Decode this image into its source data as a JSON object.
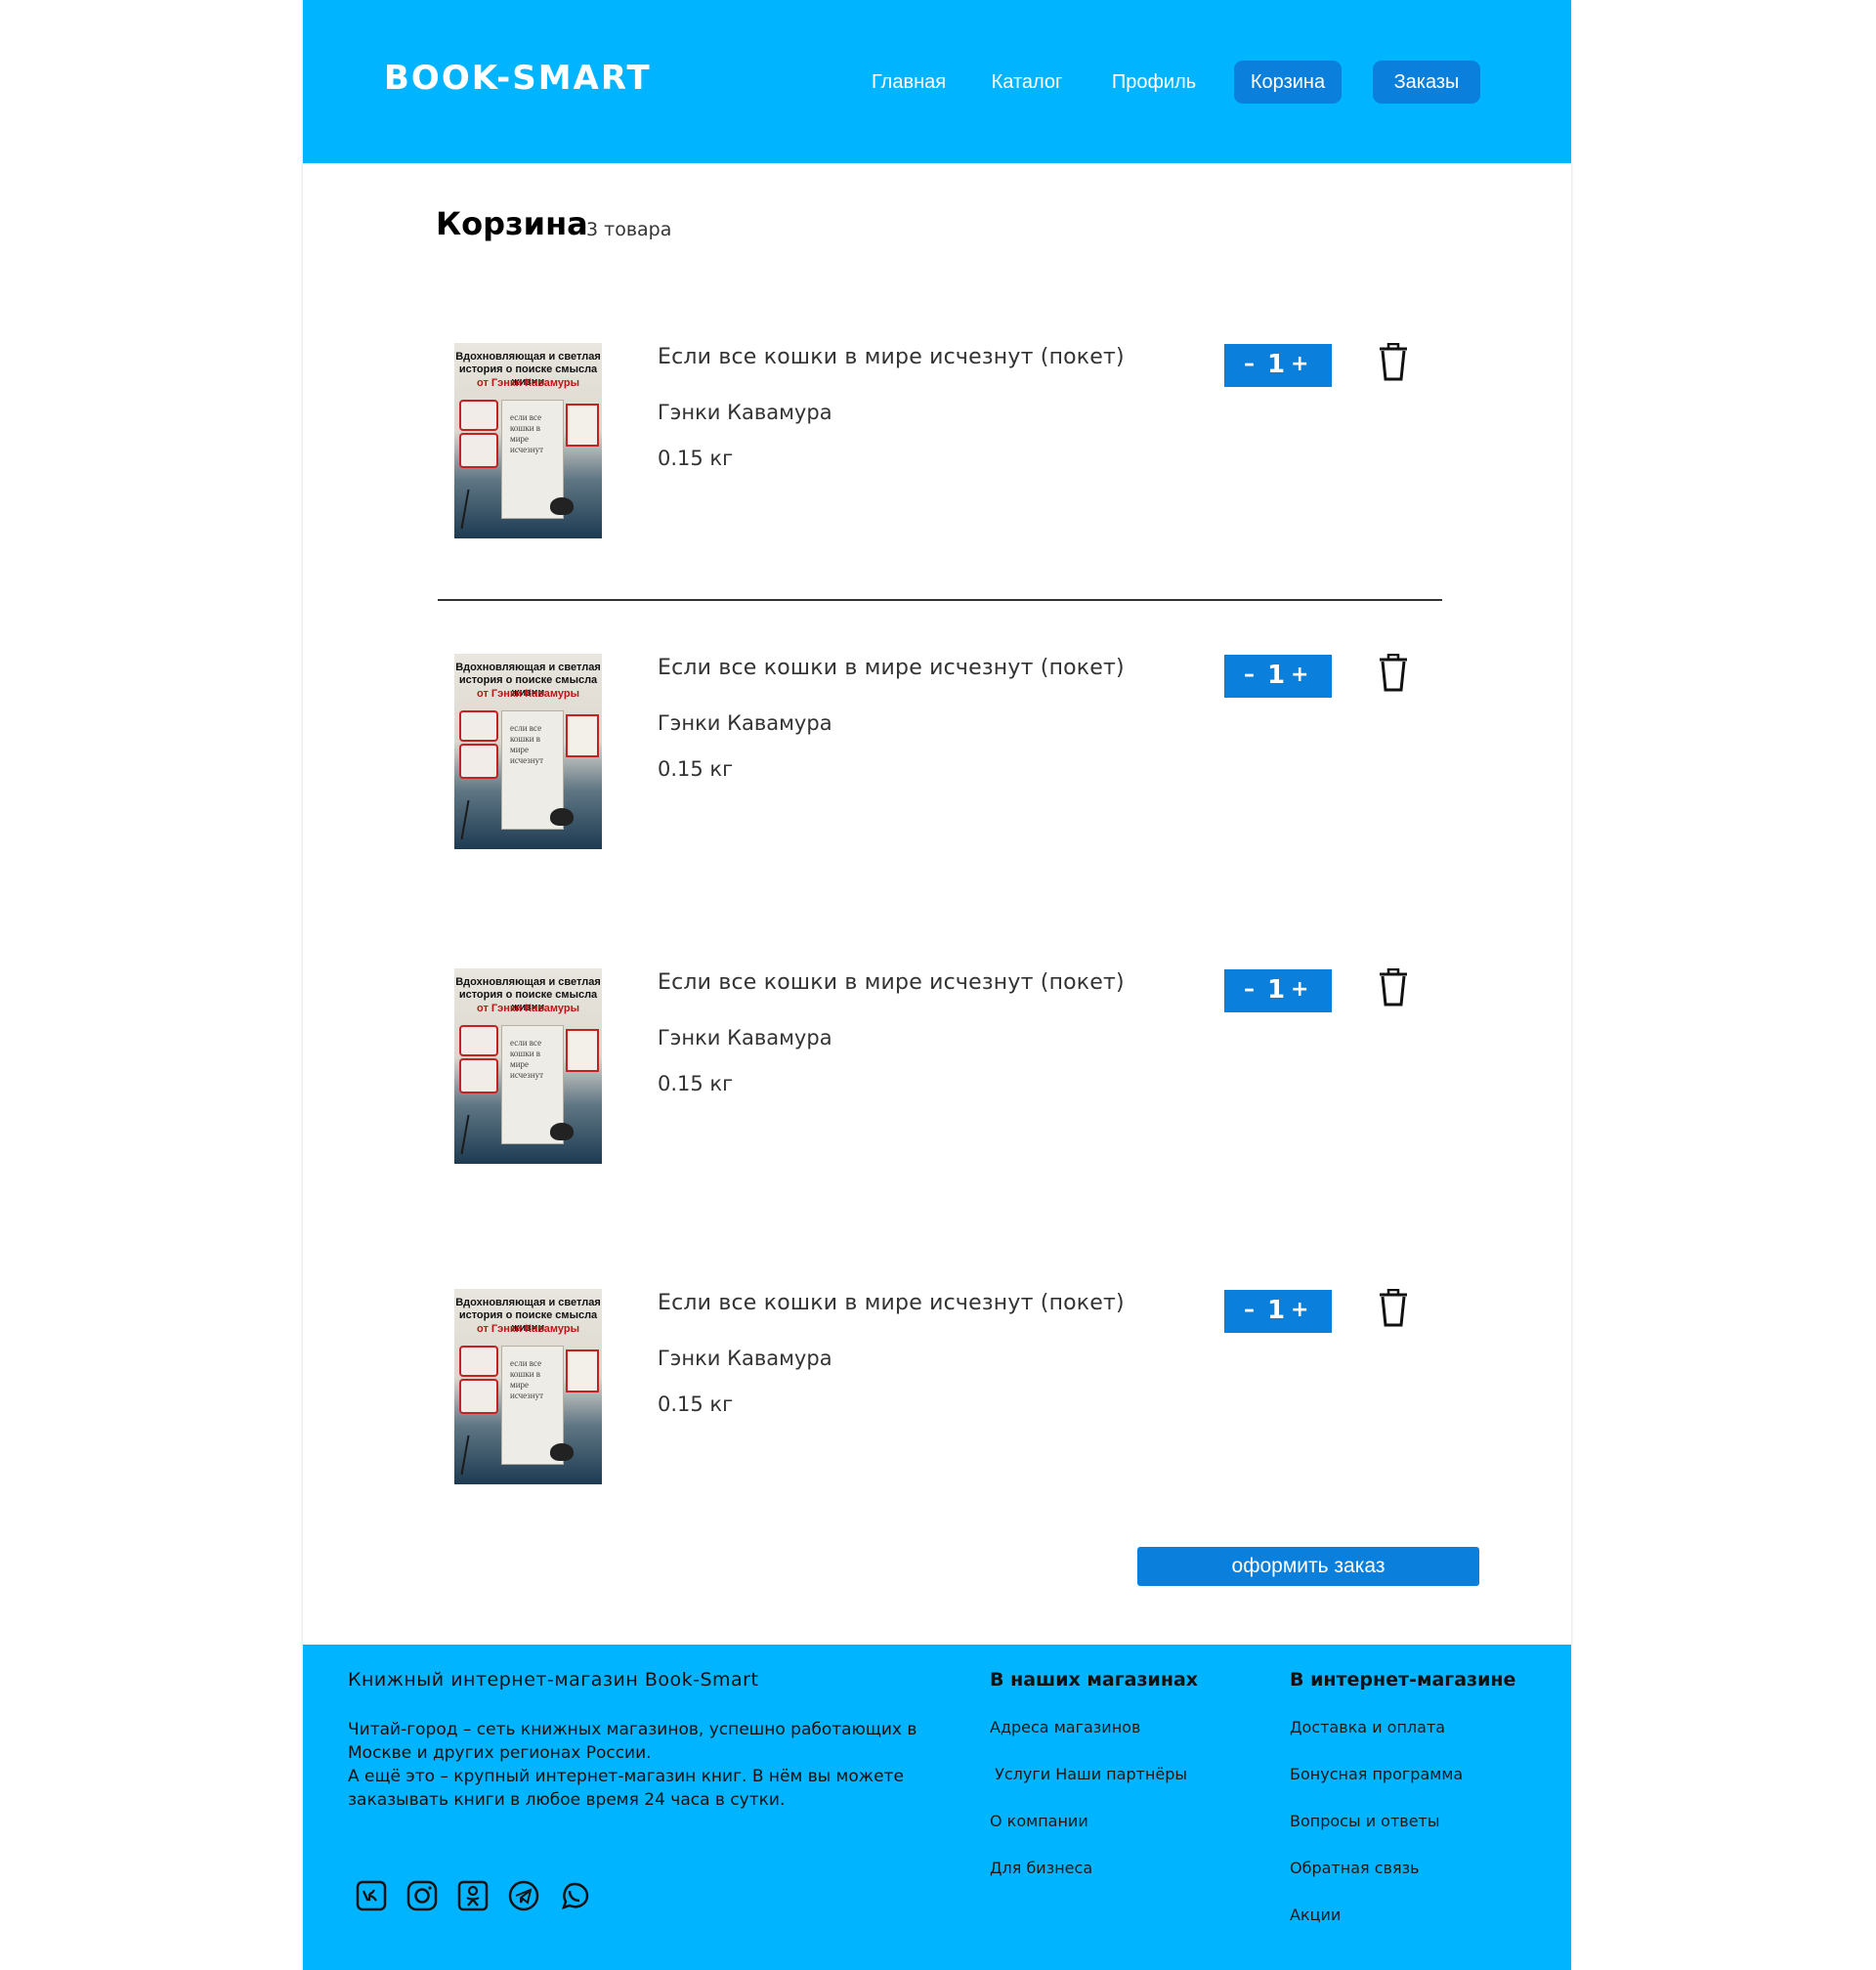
{
  "header": {
    "logo": "BOOK-SMART",
    "nav": [
      {
        "label": "Главная"
      },
      {
        "label": "Каталог"
      },
      {
        "label": "Профиль"
      },
      {
        "label": "Корзина",
        "active": true
      },
      {
        "label": "Заказы",
        "active": true
      }
    ]
  },
  "cart": {
    "title": "Корзина",
    "count": "3 товара",
    "items": [
      {
        "title": "Если все кошки в мире исчезнут (покет)",
        "author": "Гэнки Кавамура",
        "weight": "0.15 кг",
        "quantity": "1",
        "minus": "–",
        "plus": "+"
      },
      {
        "title": "Если все кошки в мире исчезнут (покет)",
        "author": "Гэнки Кавамура",
        "weight": "0.15 кг",
        "quantity": "1",
        "minus": "–",
        "plus": "+"
      },
      {
        "title": "Если все кошки в мире исчезнут (покет)",
        "author": "Гэнки Кавамура",
        "weight": "0.15 кг",
        "quantity": "1",
        "minus": "–",
        "plus": "+"
      },
      {
        "title": "Если все кошки в мире исчезнут (покет)",
        "author": "Гэнки Кавамура",
        "weight": "0.15 кг",
        "quantity": "1",
        "minus": "–",
        "plus": "+"
      }
    ],
    "cover": {
      "headline": "Вдохновляющая и светлая история о поиске смысла жизни",
      "author_line": "от Гэнки Кавамуры",
      "panel_text": "если все кошки в мире исчезнут"
    },
    "checkout_label": "оформить заказ"
  },
  "footer": {
    "title": "Книжный интернет-магазин Book-Smart",
    "desc1": "Читай-город – сеть книжных магазинов, успешно работающих в Москве и других регионах России.",
    "desc2": "А ещё это – крупный интернет-магазин книг. В нём вы можете заказывать книги в любое время 24 часа в сутки.",
    "col1": {
      "title": "В наших магазинах",
      "links": [
        "Адреса магазинов",
        " Услуги Наши партнёры",
        "О компании",
        "Для бизнеса"
      ]
    },
    "col2": {
      "title": "В интернет-магазине",
      "links": [
        "Доставка и оплата",
        "Бонусная программа",
        "Вопросы и ответы",
        "Обратная связь",
        "Акции"
      ]
    },
    "socials": [
      "vk-icon",
      "instagram-icon",
      "odnoklassniki-icon",
      "telegram-icon",
      "whatsapp-icon"
    ]
  },
  "colors": {
    "brand": "#00b4ff",
    "button": "#0a7fdc"
  }
}
